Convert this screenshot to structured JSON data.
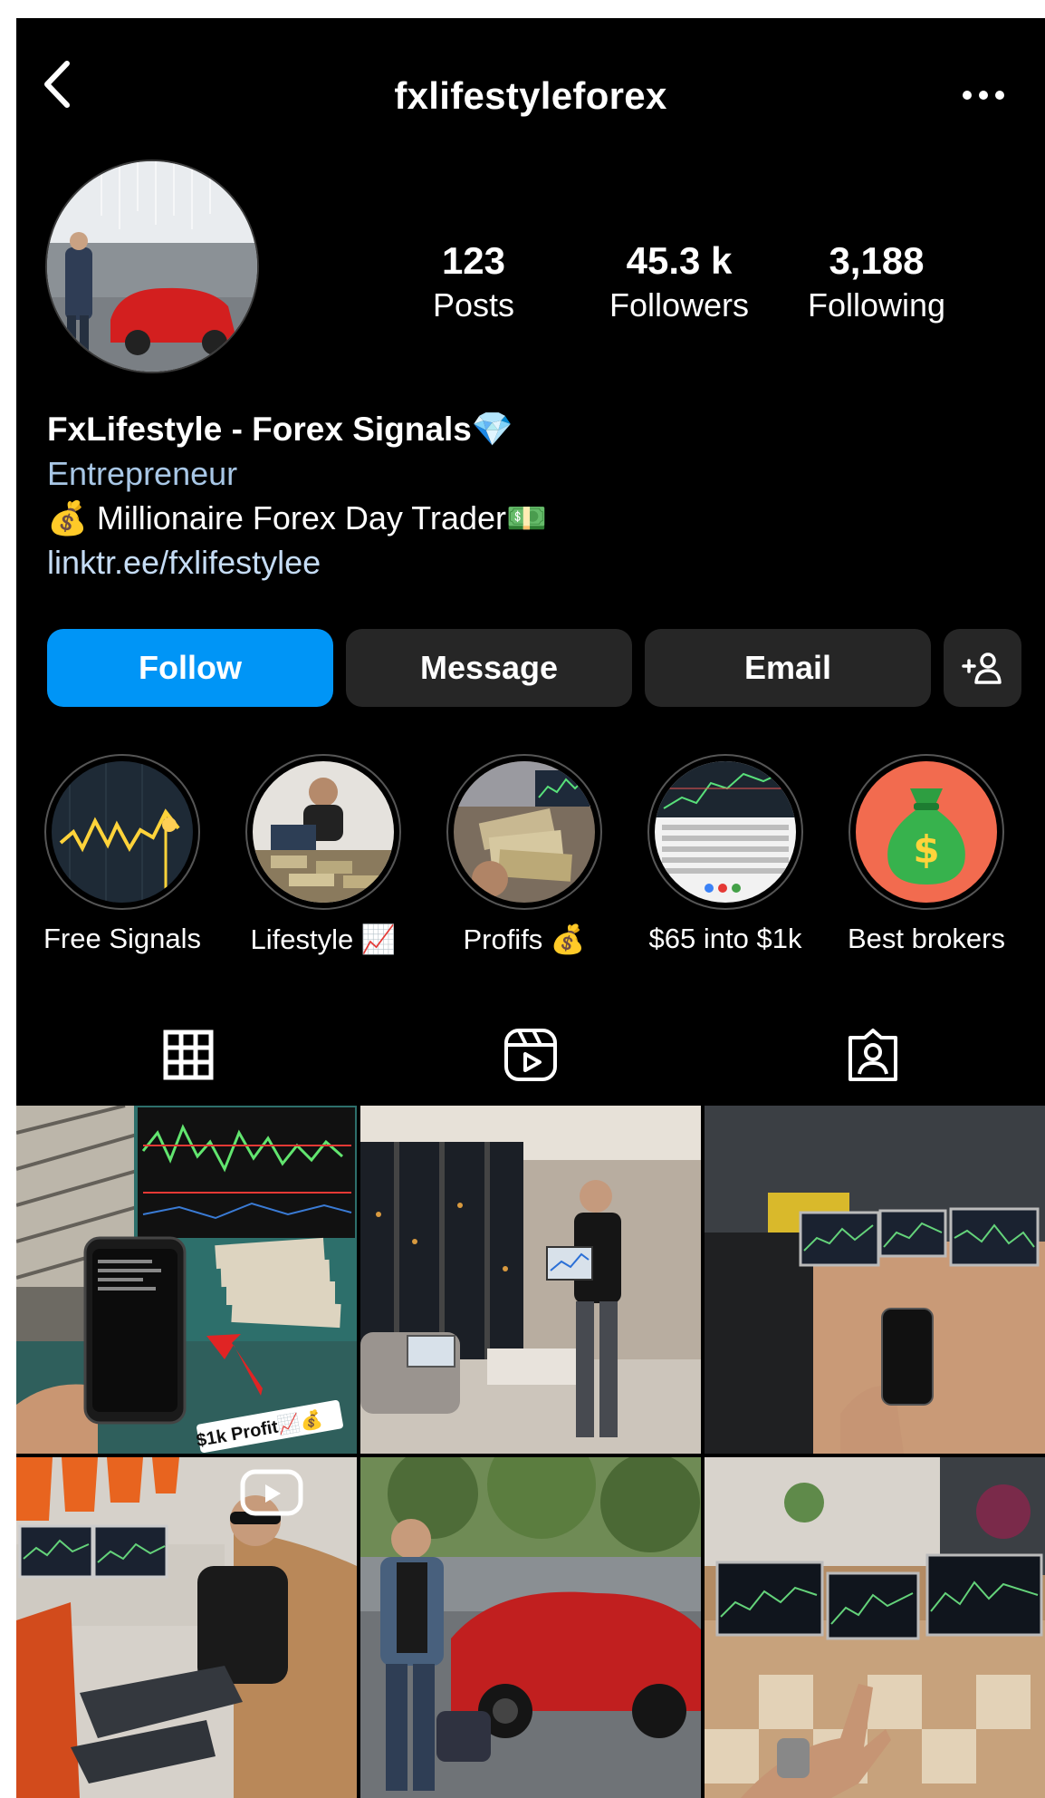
{
  "header": {
    "username": "fxlifestyleforex"
  },
  "stats": [
    {
      "value": "123",
      "label": "Posts"
    },
    {
      "value": "45.3 k",
      "label": "Followers"
    },
    {
      "value": "3,188",
      "label": "Following"
    }
  ],
  "bio": {
    "name": "FxLifestyle - Forex Signals💎",
    "category": "Entrepreneur",
    "line": "💰 Millionaire Forex Day Trader💵",
    "link": "linktr.ee/fxlifestylee"
  },
  "actions": {
    "follow": "Follow",
    "message": "Message",
    "email": "Email"
  },
  "highlights": [
    {
      "label": "Free Signals"
    },
    {
      "label": "Lifestyle 📈"
    },
    {
      "label": "Profifs 💰"
    },
    {
      "label": "$65 into $1k"
    },
    {
      "label": "Best brokers"
    }
  ],
  "posts": {
    "caption_1": "$1k Profit📈💰"
  },
  "colors": {
    "accent": "#0095f6",
    "button_bg": "#262626",
    "background": "#000000",
    "link": "#c5dcf5"
  }
}
